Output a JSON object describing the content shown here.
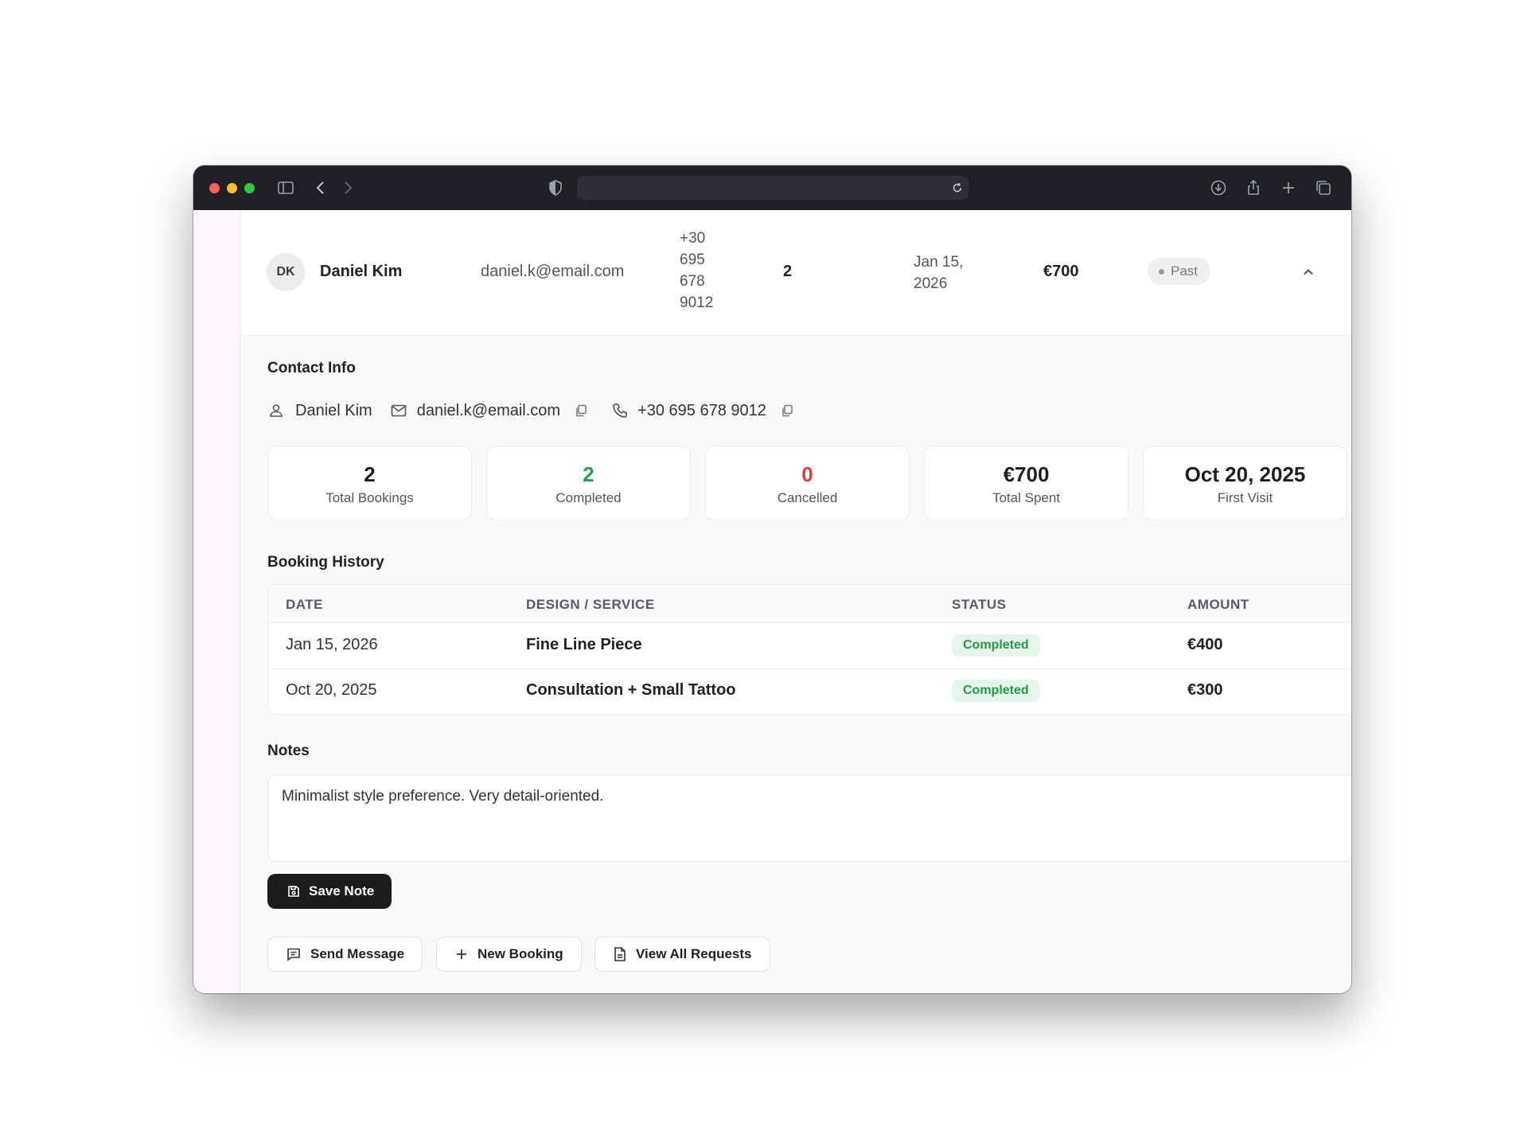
{
  "browser": {
    "url": "",
    "icons": [
      "sidebar-toggle-icon",
      "back-icon",
      "forward-icon",
      "shield-icon",
      "reload-icon",
      "download-icon",
      "share-icon",
      "new-tab-icon",
      "tabs-overview-icon"
    ]
  },
  "client_row": {
    "initials": "DK",
    "name": "Daniel Kim",
    "email": "daniel.k@email.com",
    "phone": "+30 695 678 9012",
    "bookings": "2",
    "last_visit": "Jan 15, 2026",
    "total": "€700",
    "status": "Past",
    "expanded": true
  },
  "contact_info": {
    "title": "Contact Info",
    "name": "Daniel Kim",
    "email": "daniel.k@email.com",
    "phone": "+30 695 678 9012"
  },
  "stats": [
    {
      "value": "2",
      "label": "Total Bookings",
      "color": "#1f1f22"
    },
    {
      "value": "2",
      "label": "Completed",
      "color": "#2e9e4f"
    },
    {
      "value": "0",
      "label": "Cancelled",
      "color": "#e53935"
    },
    {
      "value": "€700",
      "label": "Total Spent",
      "color": "#1f1f22"
    },
    {
      "value": "Oct 20, 2025",
      "label": "First Visit",
      "color": "#1f1f22"
    }
  ],
  "booking_history": {
    "title": "Booking History",
    "columns": [
      "DATE",
      "DESIGN / SERVICE",
      "STATUS",
      "AMOUNT"
    ],
    "rows": [
      {
        "date": "Jan 15, 2026",
        "service": "Fine Line Piece",
        "status": "Completed",
        "amount": "€400"
      },
      {
        "date": "Oct 20, 2025",
        "service": "Consultation + Small Tattoo",
        "status": "Completed",
        "amount": "€300"
      }
    ]
  },
  "notes": {
    "title": "Notes",
    "text": "Minimalist style preference. Very detail-oriented.",
    "save_label": "Save Note"
  },
  "actions": {
    "send_message": "Send Message",
    "new_booking": "New Booking",
    "view_requests": "View All Requests"
  },
  "colors": {
    "status_completed_bg": "#e6f5ea",
    "status_completed_text": "#239a45",
    "primary_button": "#1c1c1e"
  }
}
